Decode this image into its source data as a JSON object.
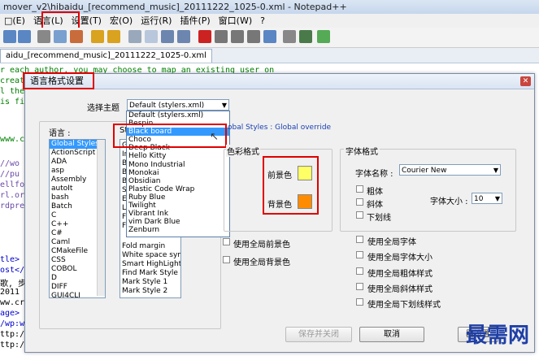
{
  "window": {
    "title": "mover_v2\\hibaidu_[recommend_music]_20111222_1025-0.xml - Notepad++"
  },
  "menu": [
    "□(E)",
    "语言(L)",
    "设置(T)",
    "宏(O)",
    "运行(R)",
    "插件(P)",
    "窗口(W)",
    "?"
  ],
  "tab": {
    "label": "aidu_[recommend_music]_20111222_1025-0.xml"
  },
  "editor_lines": [
    "r each author, you may choose to map an existing user on",
    "creat",
    "l the",
    "is fil",
    "www.c",
    "//wo",
    "//pu",
    "ellfo",
    "rl.org",
    "rdpre",
    "tle>",
    "ost</",
    "歌, 步",
    "2011",
    "ww.cr",
    "age>",
    "/wp:w",
    "ttp:/",
    "ttp:/"
  ],
  "dialog": {
    "title": "语言格式设置",
    "theme_label": "选择主题",
    "theme_value": "Default (stylers.xml)",
    "language_label": "语言 :",
    "style_label": "St",
    "style_override_text": "obal Styles : Global override",
    "color_group_label": "色彩格式",
    "font_group_label": "字体格式",
    "fg_label": "前景色",
    "bg_label": "背景色",
    "fg_color": "#ffff66",
    "bg_color": "#ff8c00",
    "font_name_label": "字体名称 :",
    "font_name_value": "Courier New",
    "bold_label": "粗体",
    "italic_label": "斜体",
    "underline_label": "下划线",
    "font_size_label": "字体大小 :",
    "font_size_value": "10",
    "global_fg_label": "使用全局前景色",
    "global_bg_label": "使用全局背景色",
    "global_font_label": "使用全局字体",
    "global_size_label": "使用全局字体大小",
    "global_bold_label": "使用全局粗体样式",
    "global_italic_label": "使用全局斜体样式",
    "global_underline_label": "使用全局下划线样式",
    "save_close_label": "保存并关闭",
    "cancel_label": "取消"
  },
  "languages": [
    "Global Styles",
    "ActionScript",
    "ADA",
    "asp",
    "Assembly",
    "autoIt",
    "bash",
    "Batch",
    "C",
    "C++",
    "C#",
    "Caml",
    "CMakeFile",
    "CSS",
    "COBOL",
    "D",
    "DIFF",
    "GUI4CLI"
  ],
  "styles_partial": [
    "Gl",
    "In",
    "Br",
    "Bo",
    "Bo",
    "Sc",
    "Ec",
    "Li",
    "Fo",
    "Fo"
  ],
  "styles_tail": [
    "Fold margin",
    "White space symbo",
    "Smart HighLighting",
    "Find Mark Style",
    "Mark Style 1",
    "Mark Style 2"
  ],
  "theme_options": [
    "Default (stylers.xml)",
    "Bespin",
    "Black board",
    "Choco",
    "Deep Black",
    "Hello Kitty",
    "Mono Industrial",
    "Monokai",
    "Obsidian",
    "Plastic Code Wrap",
    "Ruby Blue",
    "Twilight",
    "Vibrant Ink",
    "vim Dark Blue",
    "Zenburn"
  ],
  "watermark": {
    "text": "最需网",
    "small": "器设置"
  }
}
